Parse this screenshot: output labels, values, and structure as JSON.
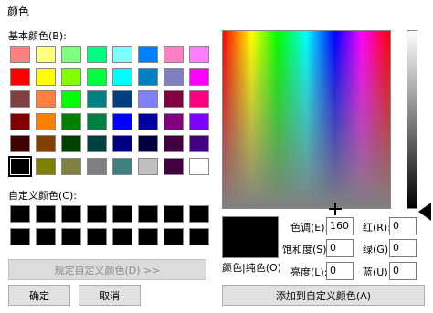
{
  "window": {
    "title": "颜色"
  },
  "basic_colors": {
    "label": "基本颜色(B):",
    "rows": [
      [
        "#ff8080",
        "#ffff80",
        "#80ff80",
        "#00ff80",
        "#80ffff",
        "#0080ff",
        "#ff80c0",
        "#ff80ff"
      ],
      [
        "#ff0000",
        "#ffff00",
        "#80ff00",
        "#00ff40",
        "#00ffff",
        "#0080c0",
        "#8080c0",
        "#ff00ff"
      ],
      [
        "#804040",
        "#ff8040",
        "#00ff00",
        "#008080",
        "#004080",
        "#8080ff",
        "#800040",
        "#ff0080"
      ],
      [
        "#800000",
        "#ff8000",
        "#008000",
        "#008040",
        "#0000ff",
        "#0000a0",
        "#800080",
        "#8000ff"
      ],
      [
        "#400000",
        "#804000",
        "#004000",
        "#004040",
        "#000080",
        "#000040",
        "#400040",
        "#400080"
      ],
      [
        "#000000",
        "#808000",
        "#808040",
        "#808080",
        "#408080",
        "#c0c0c0",
        "#400040",
        "#ffffff"
      ]
    ]
  },
  "custom_colors": {
    "label": "自定义颜色(C):",
    "rows": [
      [
        "#000000",
        "#000000",
        "#000000",
        "#000000",
        "#000000",
        "#000000",
        "#000000",
        "#000000"
      ],
      [
        "#000000",
        "#000000",
        "#000000",
        "#000000",
        "#000000",
        "#000000",
        "#000000",
        "#000000"
      ]
    ]
  },
  "buttons": {
    "define_custom": "规定自定义颜色(D) >>",
    "ok": "确定",
    "cancel": "取消",
    "add_custom": "添加到自定义颜色(A)"
  },
  "preview": {
    "label": "颜色|纯色(O)",
    "color": "#000000"
  },
  "hsl": {
    "hue_label": "色调(E):",
    "hue": "160",
    "sat_label": "饱和度(S):",
    "sat": "0",
    "lum_label": "亮度(L):",
    "lum": "0"
  },
  "rgb": {
    "red_label": "红(R):",
    "red": "0",
    "green_label": "绿(G):",
    "green": "0",
    "blue_label": "蓝(U):",
    "blue": "0"
  }
}
